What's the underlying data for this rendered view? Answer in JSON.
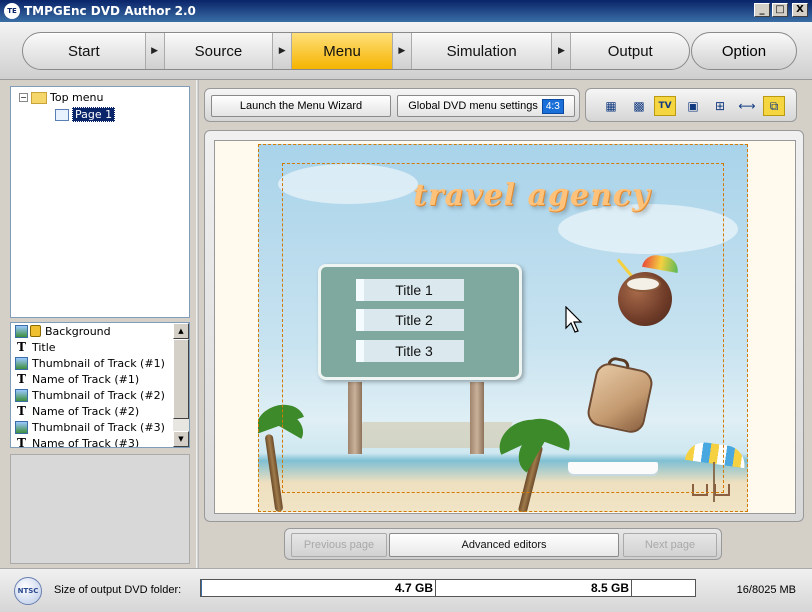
{
  "window": {
    "title": "TMPGEnc DVD Author 2.0",
    "app_icon": "TE",
    "controls": {
      "minimize": "_",
      "maximize": "□",
      "close": "X"
    }
  },
  "steps": {
    "items": [
      {
        "label": "Start"
      },
      {
        "label": "Source"
      },
      {
        "label": "Menu",
        "active": true
      },
      {
        "label": "Simulation"
      },
      {
        "label": "Output"
      }
    ],
    "arrow_glyph": "▶",
    "option_label": "Option"
  },
  "tree": {
    "root_label": "Top menu",
    "root_expander": "−",
    "child_label": "Page 1"
  },
  "objects": {
    "items": [
      {
        "label": "Background",
        "icon": "image-icon",
        "locked": true
      },
      {
        "label": "Title",
        "icon": "text-icon"
      },
      {
        "label": "Thumbnail of Track (#1)",
        "icon": "image-icon"
      },
      {
        "label": "Name of Track (#1)",
        "icon": "text-icon"
      },
      {
        "label": "Thumbnail of Track (#2)",
        "icon": "image-icon"
      },
      {
        "label": "Name of Track (#2)",
        "icon": "text-icon"
      },
      {
        "label": "Thumbnail of Track (#3)",
        "icon": "image-icon"
      },
      {
        "label": "Name of Track (#3)",
        "icon": "text-icon"
      }
    ],
    "text_icon_glyph": "T"
  },
  "toolbar": {
    "wizard_label": "Launch the Menu Wizard",
    "global_settings_label": "Global DVD menu settings",
    "aspect_ratio": "4:3",
    "tools": [
      {
        "icon": "grid-icon",
        "glyph": "▦",
        "active": false
      },
      {
        "icon": "grid-fine-icon",
        "glyph": "▩",
        "active": false
      },
      {
        "icon": "tv-safe-area-icon",
        "glyph": "TV",
        "active": true
      },
      {
        "icon": "select-frame-icon",
        "glyph": "▣",
        "active": false
      },
      {
        "icon": "align-grid-icon",
        "glyph": "⊞",
        "active": false
      },
      {
        "icon": "width-fit-icon",
        "glyph": "⟷",
        "active": false
      },
      {
        "icon": "overlap-icon",
        "glyph": "⧉",
        "active": true
      }
    ]
  },
  "canvas": {
    "logo_text": "travel agency",
    "menu_buttons": [
      "Title 1",
      "Title 2",
      "Title 3"
    ]
  },
  "navigation": {
    "prev_label": "Previous page",
    "advanced_label": "Advanced editors",
    "next_label": "Next page"
  },
  "status": {
    "format_badge": "NTSC",
    "size_label": "Size of output DVD folder:",
    "capacity_single": "4.7 GB",
    "capacity_dual": "8.5 GB",
    "usage": "16/8025 MB",
    "usage_fraction": 0.002
  },
  "colors": {
    "accent_active": "#f5b400",
    "title_bar": "#0a246a",
    "safe_area": "#d27a00"
  }
}
